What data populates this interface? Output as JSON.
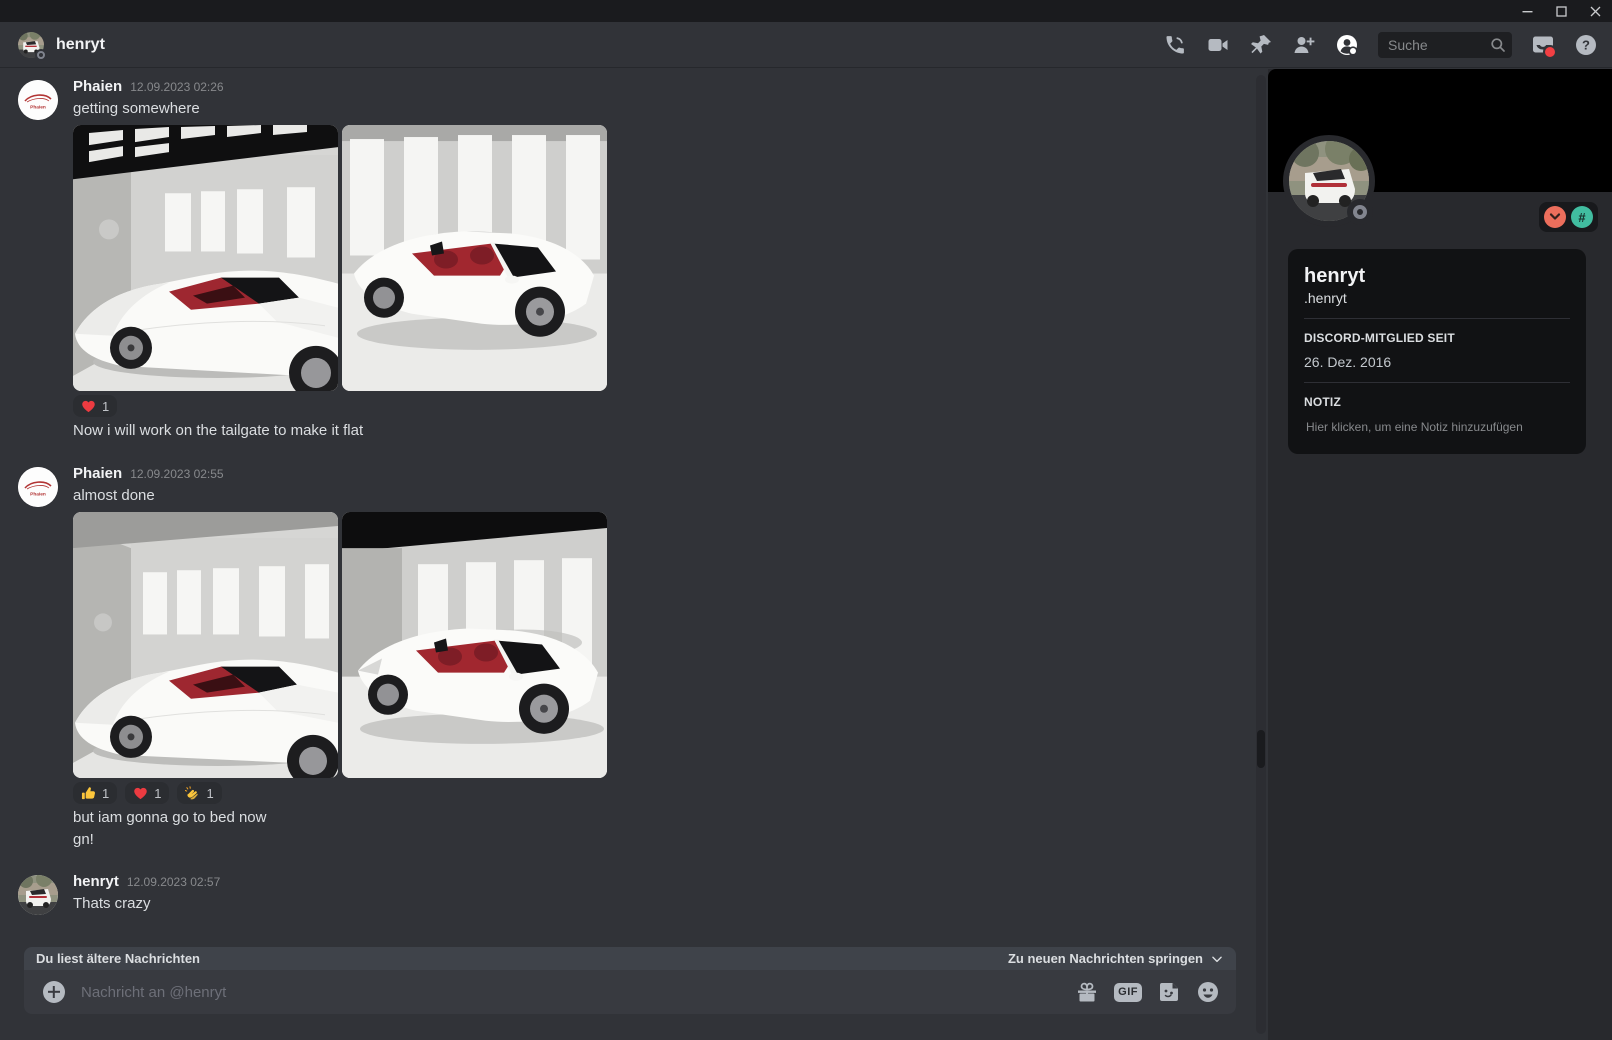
{
  "titlebar": {
    "icons": [
      "minimize-icon",
      "maximize-icon",
      "close-icon"
    ]
  },
  "header": {
    "title": "henryt",
    "search_placeholder": "Suche",
    "icons": [
      "voice-call-icon",
      "video-call-icon",
      "pin-icon",
      "add-friend-icon",
      "user-profile-icon",
      "search-icon",
      "inbox-icon",
      "help-icon"
    ]
  },
  "messages": {
    "m1": {
      "author": "Phaien",
      "timestamp": "12.09.2023 02:26",
      "text": "getting somewhere",
      "followup": "Now i will work on the tailgate to make it flat",
      "reactions": {
        "heart": "1"
      }
    },
    "m2": {
      "author": "Phaien",
      "timestamp": "12.09.2023 02:55",
      "text": "almost done",
      "followup": "but iam gonna go to bed now",
      "followup2": "gn!",
      "reactions": {
        "thumbsup": "1",
        "heart": "1",
        "clap": "1"
      }
    },
    "m3": {
      "author": "henryt",
      "timestamp": "12.09.2023 02:57",
      "text": "Thats crazy"
    }
  },
  "unread_bar": {
    "reading_older": "Du liest ältere Nachrichten",
    "jump_to_new": "Zu neuen Nachrichten springen"
  },
  "composer": {
    "placeholder": "Nachricht an @henryt",
    "gif_label": "GIF",
    "icons": [
      "gift-icon",
      "gif-icon",
      "sticker-icon",
      "emoji-icon",
      "add-attachment-icon"
    ]
  },
  "profile": {
    "display_name": "henryt",
    "username": ".henryt",
    "member_since_label": "DISCORD-MITGLIED SEIT",
    "member_since_value": "26. Dez. 2016",
    "note_label": "NOTIZ",
    "note_placeholder": "Hier klicken, um eine Notiz hinzuzufügen",
    "badges": [
      "hypesquad-badge",
      "legacy-username-badge"
    ]
  },
  "colors": {
    "chat_bg": "#313338",
    "panel_bg": "#28292d",
    "card_bg": "#111214",
    "titlebar_bg": "#1a1b1e",
    "composer_bg": "#383a40",
    "reaction_pill_bg": "#2b2d31",
    "notification_red": "#f23f43",
    "badge_coral": "#ec6e5c",
    "badge_teal": "#41bda0",
    "heart_red": "#ec3b41",
    "emoji_yellow": "#fcc63c"
  }
}
